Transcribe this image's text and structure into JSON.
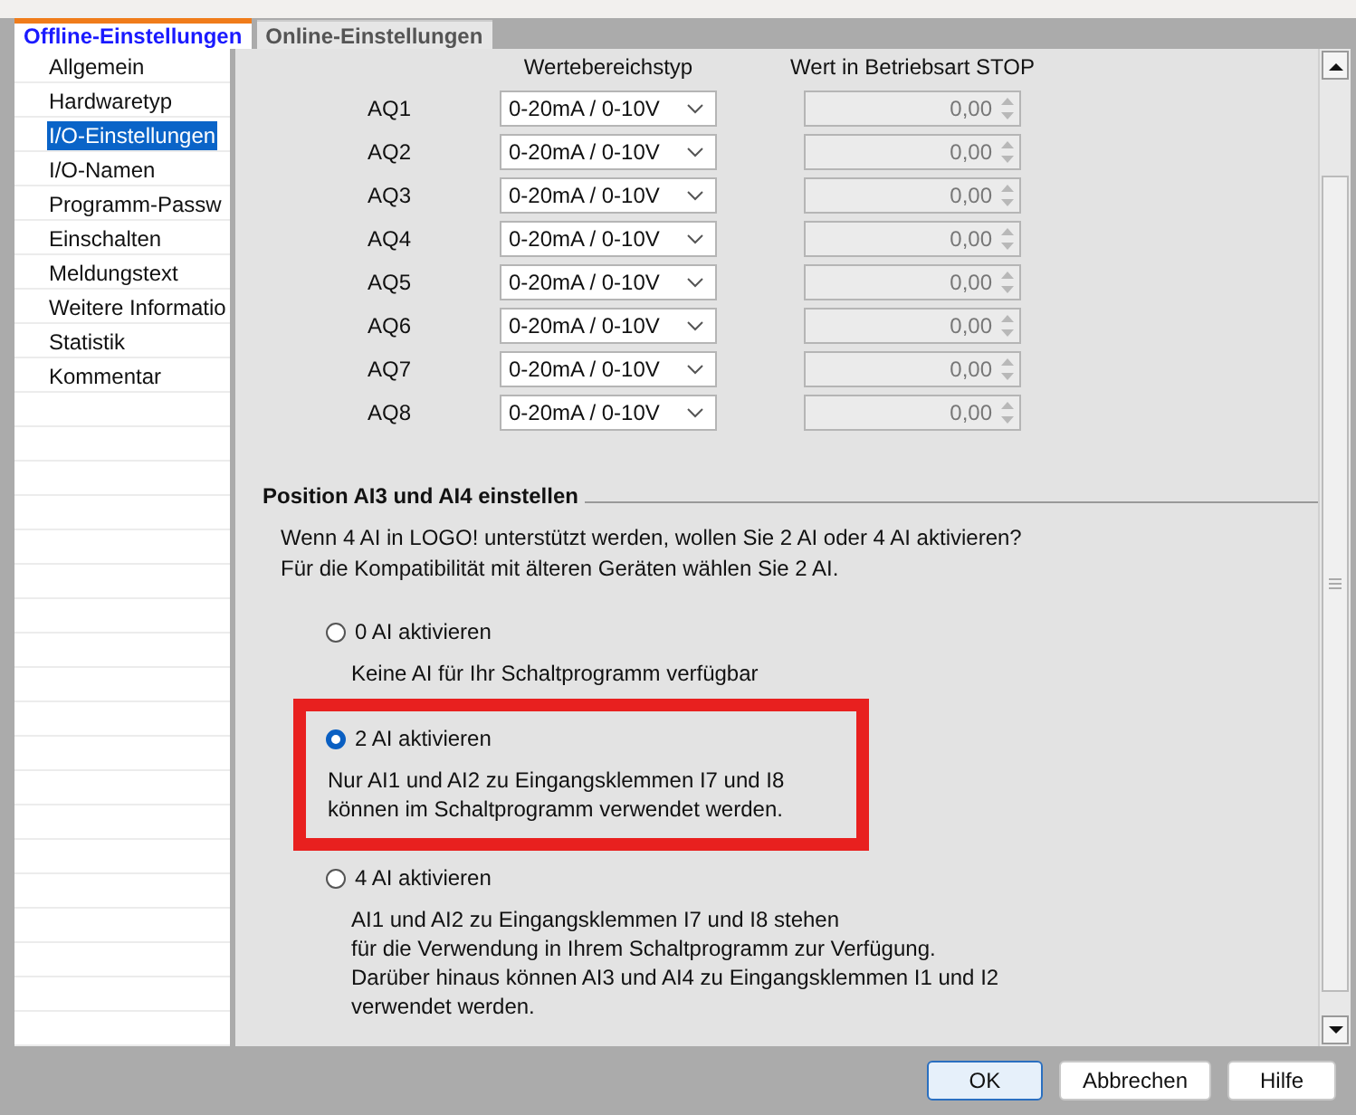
{
  "tabs": [
    {
      "label": "Offline-Einstellungen",
      "selected": true
    },
    {
      "label": "Online-Einstellungen",
      "selected": false
    }
  ],
  "sidebar": {
    "items": [
      {
        "label": "Allgemein",
        "selected": false
      },
      {
        "label": "Hardwaretyp",
        "selected": false
      },
      {
        "label": "I/O-Einstellungen",
        "selected": true
      },
      {
        "label": "I/O-Namen",
        "selected": false
      },
      {
        "label": "Programm-Passw",
        "selected": false
      },
      {
        "label": "Einschalten",
        "selected": false
      },
      {
        "label": "Meldungstext",
        "selected": false
      },
      {
        "label": "Weitere Informatio",
        "selected": false
      },
      {
        "label": "Statistik",
        "selected": false
      },
      {
        "label": "Kommentar",
        "selected": false
      }
    ]
  },
  "table": {
    "columns": [
      "Wertebereichstyp",
      "Wert in Betriebsart STOP"
    ],
    "rows": [
      {
        "label": "AQ1",
        "range": "0-20mA / 0-10V",
        "value": "0,00",
        "disabled": true
      },
      {
        "label": "AQ2",
        "range": "0-20mA / 0-10V",
        "value": "0,00",
        "disabled": true
      },
      {
        "label": "AQ3",
        "range": "0-20mA / 0-10V",
        "value": "0,00",
        "disabled": true
      },
      {
        "label": "AQ4",
        "range": "0-20mA / 0-10V",
        "value": "0,00",
        "disabled": true
      },
      {
        "label": "AQ5",
        "range": "0-20mA / 0-10V",
        "value": "0,00",
        "disabled": true
      },
      {
        "label": "AQ6",
        "range": "0-20mA / 0-10V",
        "value": "0,00",
        "disabled": true
      },
      {
        "label": "AQ7",
        "range": "0-20mA / 0-10V",
        "value": "0,00",
        "disabled": true
      },
      {
        "label": "AQ8",
        "range": "0-20mA / 0-10V",
        "value": "0,00",
        "disabled": true
      }
    ]
  },
  "section": {
    "title": "Position AI3 und AI4 einstellen",
    "intro": [
      "Wenn 4 AI in LOGO! unterstützt werden, wollen Sie 2 AI oder 4 AI aktivieren?",
      "Für die Kompatibilität mit älteren Geräten wählen Sie 2 AI."
    ],
    "options": [
      {
        "label": "0 AI aktivieren",
        "selected": false,
        "highlighted": false,
        "description": [
          "Keine AI für Ihr Schaltprogramm verfügbar"
        ]
      },
      {
        "label": "2 AI aktivieren",
        "selected": true,
        "highlighted": true,
        "description": [
          "Nur AI1 und AI2 zu Eingangsklemmen I7 und I8",
          "können im Schaltprogramm verwendet werden."
        ]
      },
      {
        "label": "4 AI aktivieren",
        "selected": false,
        "highlighted": false,
        "description": [
          "AI1 und AI2 zu Eingangsklemmen I7 und I8 stehen",
          "für die Verwendung in Ihrem Schaltprogramm zur Verfügung.",
          "Darüber hinaus können AI3 und AI4 zu Eingangsklemmen I1 und I2",
          "verwendet werden."
        ]
      }
    ]
  },
  "buttons": [
    {
      "label": "OK",
      "default": true
    },
    {
      "label": "Abbrechen",
      "default": false
    },
    {
      "label": "Hilfe",
      "default": false
    }
  ]
}
